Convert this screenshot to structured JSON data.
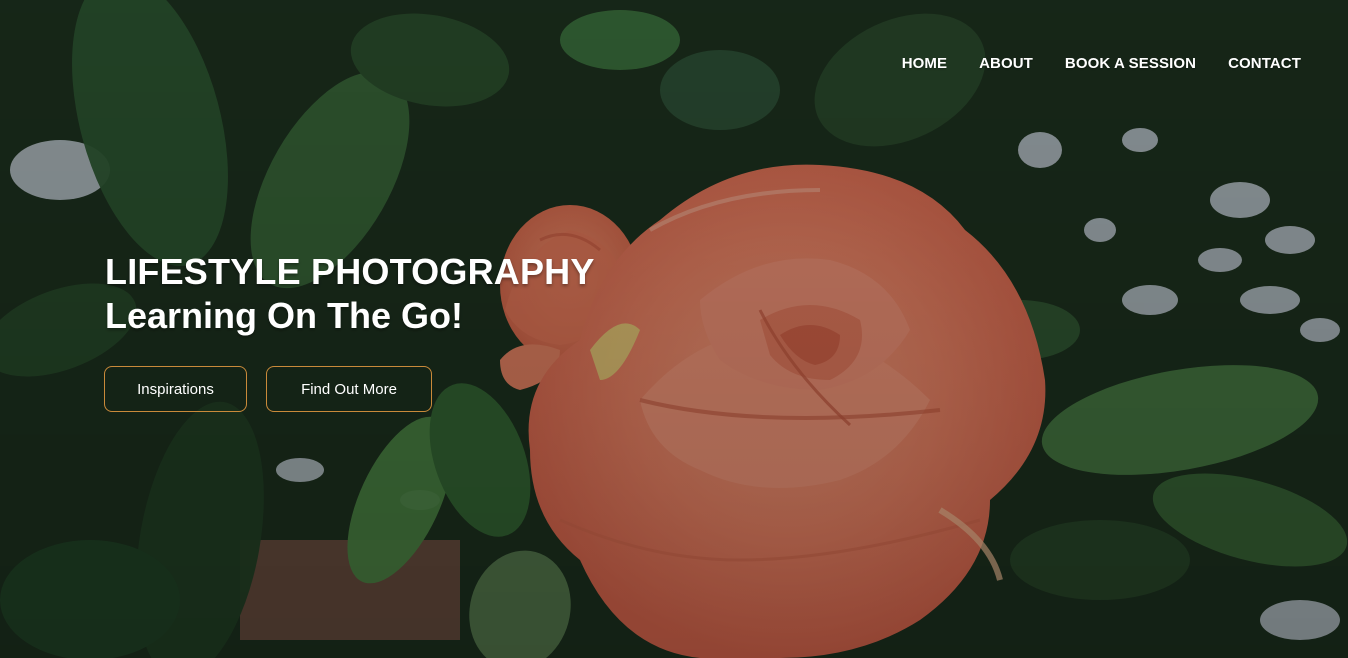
{
  "nav": {
    "items": [
      {
        "label": "HOME"
      },
      {
        "label": "ABOUT"
      },
      {
        "label": "BOOK A SESSION"
      },
      {
        "label": "CONTACT"
      }
    ]
  },
  "hero": {
    "title": "LIFESTYLE PHOTOGRAPHY",
    "subtitle": "Learning On The Go!",
    "buttons": {
      "primary_label": "Inspirations",
      "secondary_label": "Find Out More"
    },
    "background_image": "rose-among-green-leaves",
    "colors": {
      "button_border": "#c98a3a",
      "rose": "#f08a6a",
      "foliage": "#1f3a22"
    }
  }
}
